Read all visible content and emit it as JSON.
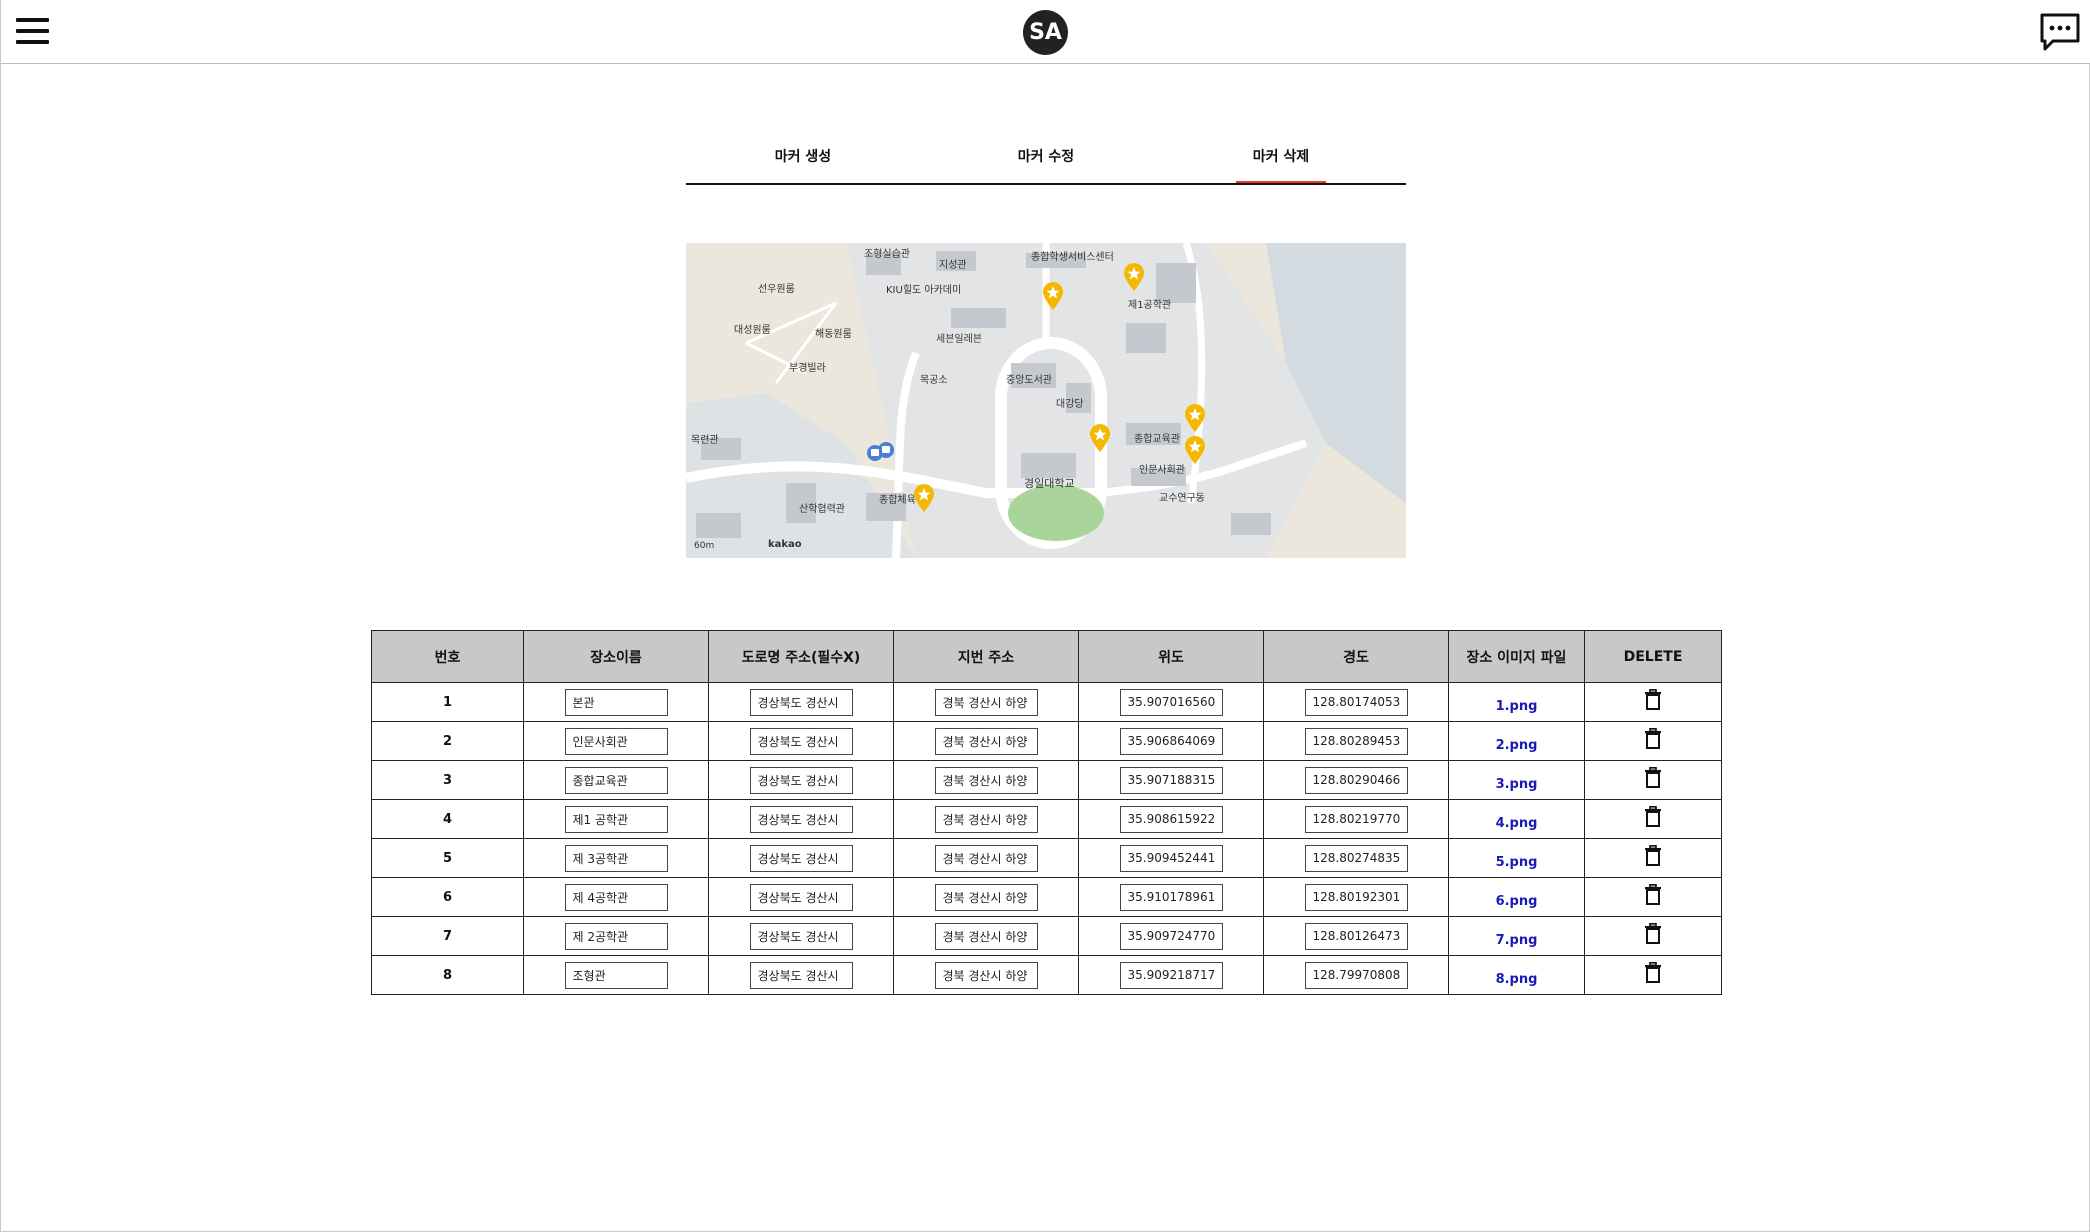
{
  "header": {
    "logo_text": "SA",
    "menu_icon": "hamburger-menu-icon",
    "chat_icon": "chat-bubble-icon"
  },
  "tabs": [
    {
      "label": "마커 생성",
      "active": false
    },
    {
      "label": "마커 수정",
      "active": false
    },
    {
      "label": "마커 삭제",
      "active": true
    }
  ],
  "map": {
    "attribution": "kakao",
    "scale": "60m",
    "labels": [
      "조형실습관",
      "지성관",
      "종합학생서비스센터",
      "선우원룸",
      "KIU힐도 아카데미",
      "제1공학관",
      "대성원룸",
      "해동원룸",
      "세븐일레븐",
      "부경빌라",
      "목공소",
      "중앙도서관",
      "대강당",
      "목련관",
      "종합교육관",
      "인문사회관",
      "경일대학교",
      "산학협력관",
      "종합체육관",
      "교수연구동"
    ],
    "marker_color": "#f5b800"
  },
  "table": {
    "headers": [
      "번호",
      "장소이름",
      "도로명 주소(필수X)",
      "지번 주소",
      "위도",
      "경도",
      "장소 이미지 파일",
      "DELETE"
    ],
    "rows": [
      {
        "no": "1",
        "name": "본관",
        "road": "경상북도 경산시",
        "jibun": "경북 경산시 하양",
        "lat": "35.90701656090",
        "lng": "128.8017405300",
        "file": "1.png"
      },
      {
        "no": "2",
        "name": "인문사회관",
        "road": "경상북도 경산시",
        "jibun": "경북 경산시 하양",
        "lat": "35.90686406902",
        "lng": "128.8028945352",
        "file": "2.png"
      },
      {
        "no": "3",
        "name": "종합교육관",
        "road": "경상북도 경산시",
        "jibun": "경북 경산시 하양",
        "lat": "35.90718831557",
        "lng": "128.8029046618",
        "file": "3.png"
      },
      {
        "no": "4",
        "name": "제1 공학관",
        "road": "경상북도 경산시",
        "jibun": "경북 경산시 하양",
        "lat": "35.90861592218",
        "lng": "128.8021977044",
        "file": "4.png"
      },
      {
        "no": "5",
        "name": "제 3공학관",
        "road": "경상북도 경산시",
        "jibun": "경북 경산시 하양",
        "lat": "35.90945244194",
        "lng": "128.8027483551",
        "file": "5.png"
      },
      {
        "no": "6",
        "name": "제 4공학관",
        "road": "경상북도 경산시",
        "jibun": "경북 경산시 하양",
        "lat": "35.91017896112",
        "lng": "128.8019230145",
        "file": "6.png"
      },
      {
        "no": "7",
        "name": "제 2공학관",
        "road": "경상북도 경산시",
        "jibun": "경북 경산시 하양",
        "lat": "35.90972477051",
        "lng": "128.8012647316",
        "file": "7.png"
      },
      {
        "no": "8",
        "name": "조형관",
        "road": "경상북도 경산시",
        "jibun": "경북 경산시 하양",
        "lat": "35.90921871775",
        "lng": "128.7997080815",
        "file": "8.png"
      }
    ],
    "delete_icon": "trash-icon",
    "link_color": "#1a1ab8",
    "header_bg": "#c8c8c8"
  }
}
